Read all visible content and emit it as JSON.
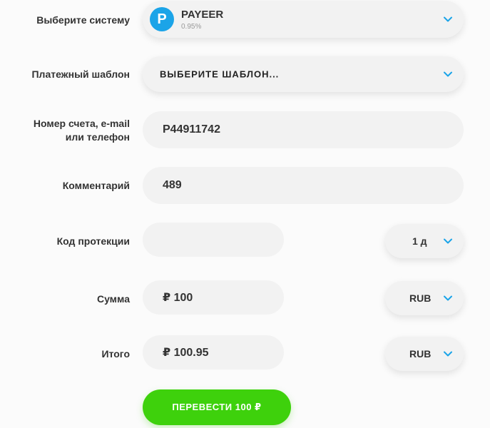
{
  "colors": {
    "accent_blue": "#1ba4e8",
    "submit_green": "#3ed10c",
    "field_bg": "#f2f2f2",
    "page_bg": "#fbfbfb"
  },
  "system": {
    "label": "Выберите систему",
    "logo_letter": "P",
    "name": "PAYEER",
    "fee": "0.95%"
  },
  "template": {
    "label": "Платежный шаблон",
    "value": "ВЫБЕРИТЕ ШАБЛОН..."
  },
  "account": {
    "label_line1": "Номер счета, e-mail",
    "label_line2": "или телефон",
    "value": "P44911742"
  },
  "comment": {
    "label": "Комментарий",
    "value": "489"
  },
  "protection": {
    "label": "Код протекции",
    "code_value": "",
    "period_value": "1 д"
  },
  "amount": {
    "label": "Сумма",
    "value": "₽ 100",
    "currency": "RUB"
  },
  "total": {
    "label": "Итого",
    "value": "₽ 100.95",
    "currency": "RUB"
  },
  "submit": {
    "label": "ПЕРЕВЕСТИ 100 ₽"
  },
  "icons": {
    "dropdown": "chevron-down-icon",
    "system_logo": "payeer-logo"
  }
}
